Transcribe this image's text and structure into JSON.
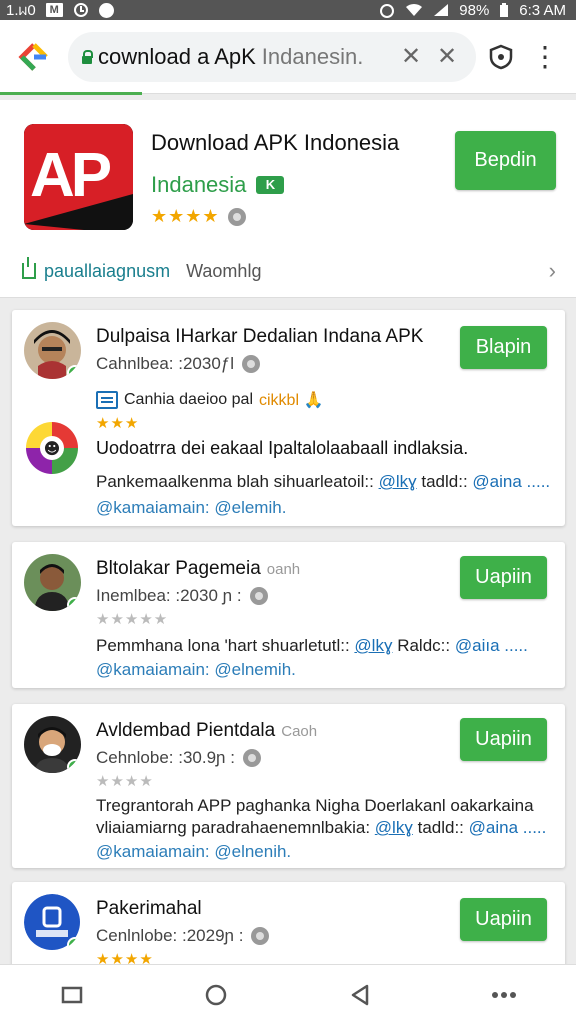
{
  "status_bar": {
    "time": "1.ᥕ0",
    "m_label": "M",
    "battery": "98%",
    "clock_right": "6:3 AM"
  },
  "browser": {
    "url_main": "cownload a ApK",
    "url_rest": "Indanesin.",
    "clear_glyph": "✕",
    "close_glyph": "✕",
    "menu_glyph": "⋮"
  },
  "header_app": {
    "title": "Download APK Indonesia",
    "subtitle": "Indanesia",
    "badge": "K",
    "stars": "★★★★",
    "install_label": "Bepdin",
    "link_text": "pauallaiagnusm",
    "link_meta": "Waomhlg",
    "chevron": "›",
    "icon_letters": "AP"
  },
  "reviews": [
    {
      "name": "Dulpaisa IHarkar Dedalian Indana APK",
      "name_extra": "",
      "date": "Cahnlbea: :2030ƒl",
      "stars_gold": "★★★",
      "stars_grey": "",
      "button": "Blapin",
      "note": "Canhia daeioo pal",
      "note_tag": "cikkbl 🙏",
      "body": "Uodoatrra dei eakaal Ipaltalolaabaall indlaksia.",
      "meta_text": "Pankemaalkenma blah sihuarleatoil::",
      "meta_link": "@lkɣ",
      "meta_mid": " tadld::",
      "meta_link2": "@aina .....",
      "foot": "@kamaiamain: @elemih."
    },
    {
      "name": "Bltolakar Pagemeia",
      "name_extra": "oanh",
      "date": "Inemlbea: :2030 ɲ :",
      "stars_gold": "",
      "stars_grey": "★★★★★",
      "button": "Uapiin",
      "meta_text": "Pemmhana lona 'hart shuarletutl::",
      "meta_link": "@lkɣ",
      "meta_mid": " Raldc::",
      "meta_link2": "@aiıa .....",
      "foot": "@kamaiamain: @elnemih."
    },
    {
      "name": "Avldembad Pientdala",
      "name_extra": "Caoh",
      "date": "Cehnlobe: :30.9ɲ :",
      "stars_gold": "",
      "stars_grey": "★★★★",
      "button": "Uapiin",
      "line1": "Tregrantorah APP paghanka Nigha Doerlakanl oakarkaina",
      "meta_text": "vliaiamiarng paradrahaenemnlbakia:",
      "meta_link": "@lkɣ",
      "meta_mid": " tadld::",
      "meta_link2": "@aina .....",
      "foot": "@kamaiamain: @elnenih."
    },
    {
      "name": "Pakerimahal",
      "name_extra": "",
      "date": "Cenlnlobe: :2029ɲ :",
      "stars_gold": "★★★★",
      "stars_grey": "",
      "button": "Uapiin"
    }
  ],
  "colors": {
    "accent_green": "#3eb049",
    "link_blue": "#1a6fb5",
    "star_gold": "#f2a600"
  }
}
